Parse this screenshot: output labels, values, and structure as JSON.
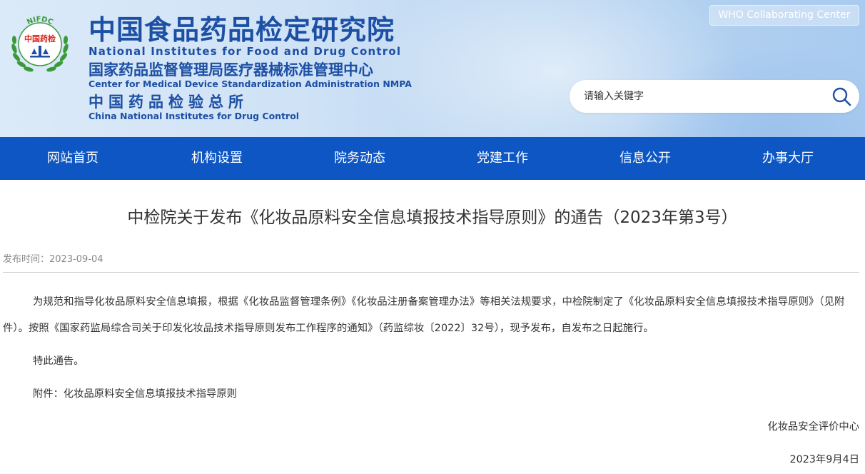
{
  "header": {
    "logo_text_top": "NIFDC",
    "logo_text_mid": "中国药检",
    "title_cn": "中国食品药品检定研究院",
    "title_en": "National Institutes for Food and Drug Control",
    "subtitle_cn": "国家药品监督管理局医疗器械标准管理中心",
    "subtitle_en": "Center for Medical Device Standardization Administration NMPA",
    "third_cn": "中国药品检验总所",
    "third_en": "China National Institutes for Drug Control",
    "who_label": "WHO Collaborating Center",
    "search_placeholder": "请输入关键字"
  },
  "nav": {
    "items": [
      "网站首页",
      "机构设置",
      "院务动态",
      "党建工作",
      "信息公开",
      "办事大厅"
    ]
  },
  "article": {
    "title": "中检院关于发布《化妆品原料安全信息填报技术指导原则》的通告（2023年第3号）",
    "publish_label": "发布时间：",
    "publish_date": "2023-09-04",
    "paragraph1": "为规范和指导化妆品原料安全信息填报，根据《化妆品监督管理条例》《化妆品注册备案管理办法》等相关法规要求，中检院制定了《化妆品原料安全信息填报技术指导原则》（见附件）。按照《国家药监局综合司关于印发化妆品技术指导原则发布工作程序的通知》（药监综妆〔2022〕32号），现予发布，自发布之日起施行。",
    "paragraph2": "特此通告。",
    "attachment_label": "附件：",
    "attachment_link": "化妆品原料安全信息填报技术指导原则",
    "signature": "化妆品安全评价中心",
    "sign_date": "2023年9月4日"
  },
  "colors": {
    "nav_bg": "#0d56c3",
    "title_blue": "#1d4fa4",
    "logo_green": "#3a9a3a",
    "logo_red": "#d8251c"
  }
}
